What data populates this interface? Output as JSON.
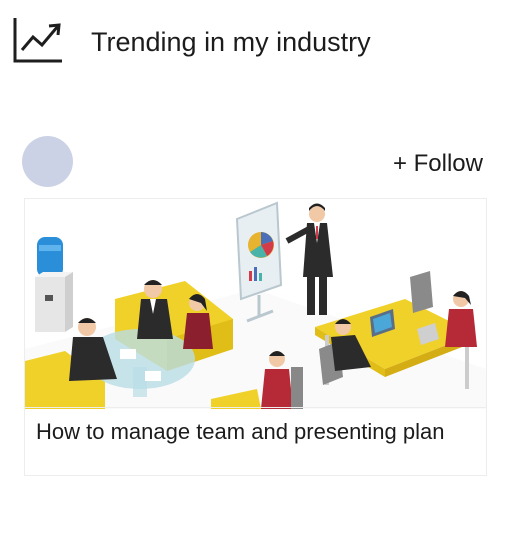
{
  "header": {
    "icon": "trending-chart-icon",
    "title": "Trending in my industry"
  },
  "post": {
    "avatar_color": "#ccd2e6",
    "follow_label": "+ Follow",
    "card": {
      "image": "team-meeting-presentation-illustration",
      "title": "How to manage team and presenting plan"
    }
  }
}
